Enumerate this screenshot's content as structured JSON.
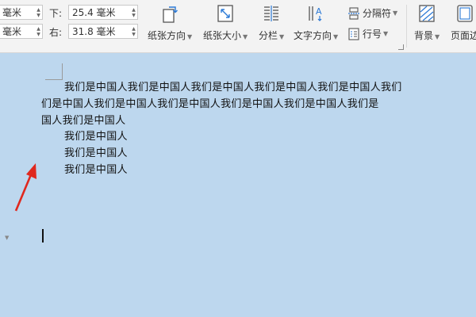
{
  "margins": {
    "top_left_unit": "毫米",
    "bottom_left_unit": "毫米",
    "bottom_label": "下:",
    "bottom_value": "25.4 毫米",
    "right_label": "右:",
    "right_value": "31.8 毫米"
  },
  "ribbon": {
    "paper_direction": "纸张方向",
    "paper_size": "纸张大小",
    "columns": "分栏",
    "text_direction": "文字方向",
    "separator": "分隔符",
    "line_number": "行号",
    "background": "背景",
    "page_border": "页面边"
  },
  "icons": {
    "paper_direction": "paper-orientation-icon",
    "paper_size": "paper-size-icon",
    "columns": "columns-icon",
    "text_direction": "text-direction-icon",
    "separator": "separator-icon",
    "line_number": "line-number-icon",
    "background": "background-icon",
    "page_border": "page-border-icon"
  },
  "document": {
    "lines": [
      "我们是中国人我们是中国人我们是中国人我们是中国人我们是中国人我们",
      "们是中国人我们是中国人我们是中国人我们是中国人我们是中国人我们是",
      "国人我们是中国人",
      "我们是中国人",
      "我们是中国人",
      "我们是中国人"
    ]
  },
  "colors": {
    "page_background": "#bdd7ee",
    "ribbon_background": "#f3f3f3",
    "annotation_arrow": "#e0281e"
  }
}
